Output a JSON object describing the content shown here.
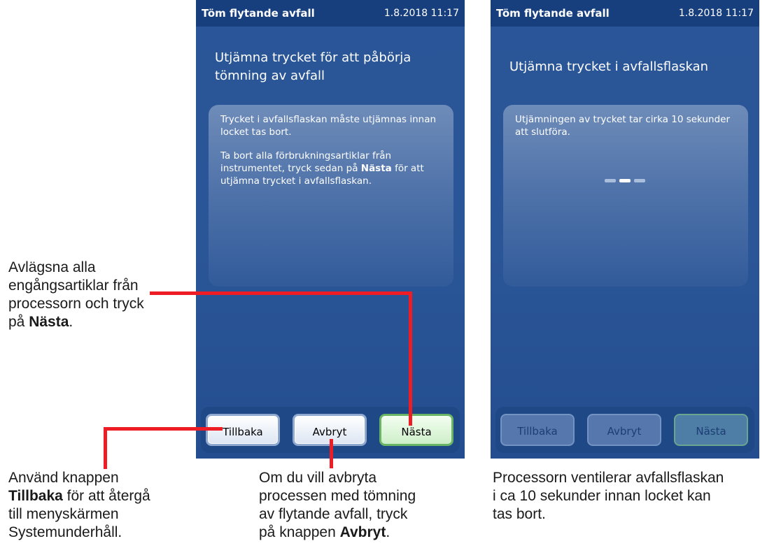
{
  "screens": [
    {
      "title": "Töm flytande avfall",
      "datetime": "1.8.2018 11:17",
      "heading_line1": "Utjämna trycket för att påbörja",
      "heading_line2": "tömning av avfall",
      "panel_p1": "Trycket i avfallsflaskan måste utjämnas innan locket tas bort.",
      "panel_p2_pre": "Ta bort alla förbrukningsartiklar från instrumentet, tryck sedan på ",
      "panel_p2_bold": "Nästa",
      "panel_p2_post": " för att utjämna trycket i avfallsflaskan.",
      "buttons": {
        "back": "Tillbaka",
        "cancel": "Avbryt",
        "next": "Nästa"
      },
      "state": "active"
    },
    {
      "title": "Töm flytande avfall",
      "datetime": "1.8.2018 11:17",
      "heading": "Utjämna trycket i avfallsflaskan",
      "panel_text": "Utjämningen av trycket tar cirka 10 sekunder att slutföra.",
      "progress_indicator": "three-dash spinner",
      "buttons": {
        "back": "Tillbaka",
        "cancel": "Avbryt",
        "next": "Nästa"
      },
      "state": "disabled"
    }
  ],
  "callouts": {
    "remove": {
      "line1": "Avlägsna alla",
      "line2": "engångsartiklar från",
      "line3": "processorn och tryck",
      "pre": "på ",
      "bold": "Nästa",
      "post": "."
    },
    "back": {
      "line1": "Använd knappen",
      "bold": "Tillbaka",
      "line2_post": " för att återgå",
      "line3": "till menyskärmen",
      "line4": "Systemunderhåll."
    },
    "cancel": {
      "line1": "Om du vill avbryta",
      "line2": "processen med tömning",
      "line3": "av flytande avfall, tryck",
      "pre": "på knappen ",
      "bold": "Avbryt",
      "post": "."
    },
    "vent": {
      "line1": "Processorn ventilerar avfallsflaskan",
      "line2": "i ca 10 sekunder innan locket kan",
      "line3": "tas bort."
    }
  },
  "colors": {
    "titlebar": "#173f7e",
    "screen": "#2a5699",
    "callout_line": "#ee1c25"
  }
}
